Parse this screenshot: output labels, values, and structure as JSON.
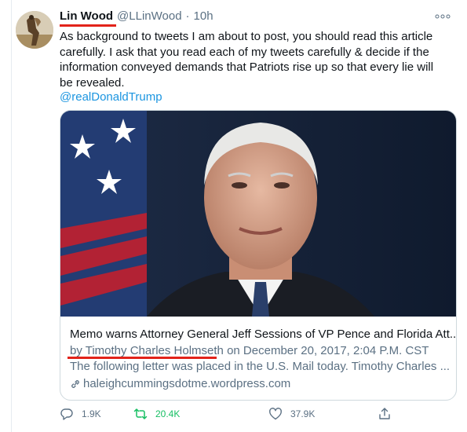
{
  "tweet": {
    "author_name": "Lin Wood",
    "handle": "@LLinWood",
    "separator": "·",
    "time": "10h",
    "text": "As background to tweets I am about to post, you should read this article carefully. I ask that you read each of my tweets carefully & decide if the information conveyed demands that Patriots rise up so that every lie will be revealed.",
    "mention": "@realDonaldTrump",
    "more_icon": "more-dots-icon"
  },
  "card": {
    "title": "Memo warns Attorney General Jeff Sessions of VP Pence and Florida Att...",
    "desc_byline": "by Timothy Charles Holmseth",
    "desc_rest": " on December 20, 2017, 2:04 P.M. CST The following letter was placed in the U.S. Mail today. Timothy Charles ...",
    "domain": "haleighcummingsdotme.wordpress.com"
  },
  "actions": {
    "reply_count": "1.9K",
    "retweet_count": "20.4K",
    "like_count": "37.9K",
    "retweet_color": "#17bf63"
  },
  "colors": {
    "annotation_red": "#e2231a",
    "link_blue": "#1b95e0",
    "muted": "#5b7083"
  }
}
